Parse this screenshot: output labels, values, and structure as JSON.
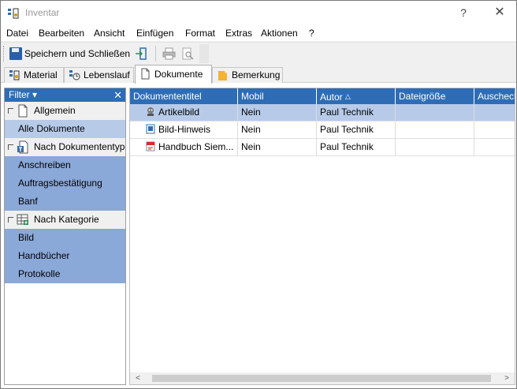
{
  "window": {
    "title": "Inventar",
    "help_label": "?",
    "close_label": "✕"
  },
  "menu": [
    {
      "label": "Datei"
    },
    {
      "label": "Bearbeiten"
    },
    {
      "label": "Ansicht"
    },
    {
      "label": "Einfügen"
    },
    {
      "label": "Format"
    },
    {
      "label": "Extras"
    },
    {
      "label": "Aktionen"
    },
    {
      "label": "?"
    }
  ],
  "toolbar": {
    "save_close_label": "Speichern und Schließen"
  },
  "tabs": [
    {
      "label": "Material",
      "icon": "material-icon"
    },
    {
      "label": "Lebenslauf",
      "icon": "history-icon"
    },
    {
      "label": "Dokumente",
      "icon": "document-icon",
      "active": true
    },
    {
      "label": "Bemerkung",
      "icon": "note-icon"
    }
  ],
  "filter": {
    "header": "Filter ▾",
    "close": "✕",
    "groups": [
      {
        "label": "Allgemein",
        "icon": "document-icon",
        "items": [
          {
            "label": "Alle Dokumente",
            "selected": true
          }
        ]
      },
      {
        "label": "Nach Dokumententyp",
        "icon": "doctype-icon",
        "items": [
          {
            "label": "Anschreiben"
          },
          {
            "label": "Auftragsbestätigung"
          },
          {
            "label": "Banf"
          }
        ]
      },
      {
        "label": "Nach Kategorie",
        "icon": "category-icon",
        "items": [
          {
            "label": "Bild"
          },
          {
            "label": "Handbücher"
          },
          {
            "label": "Protokolle"
          }
        ]
      }
    ]
  },
  "grid": {
    "columns": [
      "Dokumententitel",
      "Mobil",
      "Autor",
      "Dateigröße",
      "Auschecken"
    ],
    "sort_indicator": "△",
    "rows": [
      {
        "title": "Artikelbild",
        "mobil": "Nein",
        "autor": "Paul Technik",
        "size": "",
        "checkout": "",
        "icon": "image-file-icon",
        "selected": true
      },
      {
        "title": "Bild-Hinweis",
        "mobil": "Nein",
        "autor": "Paul Technik",
        "size": "",
        "checkout": "",
        "icon": "word-file-icon"
      },
      {
        "title": "Handbuch Siem...",
        "mobil": "Nein",
        "autor": "Paul Technik",
        "size": "",
        "checkout": "",
        "icon": "pdf-file-icon"
      }
    ]
  },
  "scrollbar": {
    "left": "<",
    "right": ">"
  },
  "colors": {
    "header_blue": "#2e6db5",
    "filter_item_blue": "#8aa8d8",
    "selection_blue": "#b7cbe9"
  }
}
